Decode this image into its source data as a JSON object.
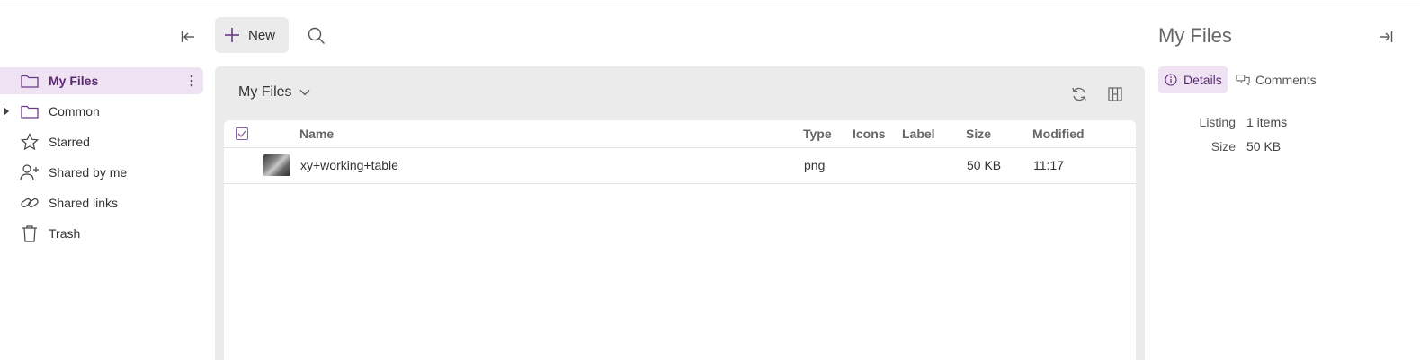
{
  "toolbar": {
    "new_label": "New"
  },
  "sidebar": {
    "items": [
      {
        "label": "My Files",
        "icon": "folder-icon"
      },
      {
        "label": "Common",
        "icon": "folder-icon"
      },
      {
        "label": "Starred",
        "icon": "star-icon"
      },
      {
        "label": "Shared by me",
        "icon": "user-plus-icon"
      },
      {
        "label": "Shared links",
        "icon": "link-icon"
      },
      {
        "label": "Trash",
        "icon": "trash-icon"
      }
    ]
  },
  "main": {
    "folder_title": "My Files",
    "columns": [
      "Name",
      "Type",
      "Icons",
      "Label",
      "Size",
      "Modified"
    ],
    "rows": [
      {
        "name": "xy+working+table",
        "type": "png",
        "icons": "",
        "label": "",
        "size": "50 KB",
        "modified": "11:17"
      }
    ]
  },
  "details": {
    "title": "My Files",
    "tabs": [
      "Details",
      "Comments"
    ],
    "properties": [
      {
        "label": "Listing",
        "value": "1 items"
      },
      {
        "label": "Size",
        "value": "50 KB"
      }
    ]
  },
  "colors": {
    "accent": "#5b2a74",
    "active_bg": "#efe3f3",
    "panel_bg": "#ebebeb"
  }
}
